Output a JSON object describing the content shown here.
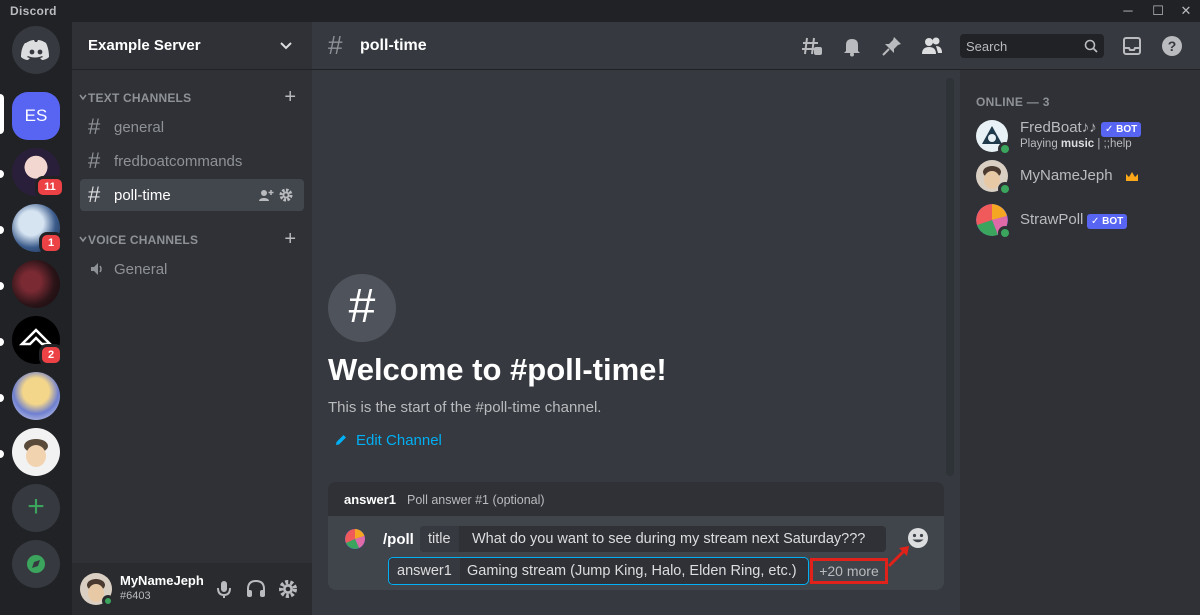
{
  "window": {
    "app_title": "Discord",
    "minimize": "─",
    "maximize": "☐",
    "close": "✕"
  },
  "servers": {
    "home_icon": "discord-logo-icon",
    "items": [
      {
        "initials": "ES",
        "active": true
      },
      {
        "badge": "11"
      },
      {
        "badge": "1"
      },
      {
        "badge": ""
      },
      {
        "badge": "2"
      },
      {
        "badge": ""
      },
      {
        "badge": ""
      }
    ],
    "add_icon": "+",
    "explore_icon": "compass-icon"
  },
  "sidebar": {
    "server_name": "Example Server",
    "categories": [
      {
        "label": "TEXT CHANNELS"
      },
      {
        "label": "VOICE CHANNELS"
      }
    ],
    "text_channels": [
      "general",
      "fredboatcommands",
      "poll-time"
    ],
    "voice_channels": [
      "General"
    ],
    "user": {
      "name": "MyNameJeph",
      "tag": "#6403"
    }
  },
  "chat": {
    "channel_name": "poll-time",
    "search_placeholder": "Search",
    "welcome_title": "Welcome to #poll-time!",
    "welcome_sub": "This is the start of the #poll-time channel.",
    "edit_channel": "Edit Channel",
    "option_popup": {
      "name": "answer1",
      "desc": "Poll answer #1 (optional)"
    },
    "composer": {
      "command": "/poll",
      "title_key": "title",
      "title_value": "What do you want to see during my stream next Saturday???",
      "answer_key": "answer1",
      "answer_value": "Gaming stream (Jump King, Halo, Elden Ring, etc.)",
      "more": "+20 more"
    }
  },
  "members": {
    "heading": "ONLINE — 3",
    "list": [
      {
        "name": "FredBoat♪♪",
        "badge": "BOT",
        "activity_prefix": "Playing ",
        "activity_bold": "music",
        "activity_suffix": " | ;;help"
      },
      {
        "name": "MyNameJeph"
      },
      {
        "name": "StrawPoll",
        "badge": "BOT"
      }
    ]
  },
  "colors": {
    "blurple": "#5865f2",
    "online": "#3ba55d",
    "mention": "#ed4245",
    "link": "#00aff4",
    "annotation_red": "#e0221a"
  }
}
